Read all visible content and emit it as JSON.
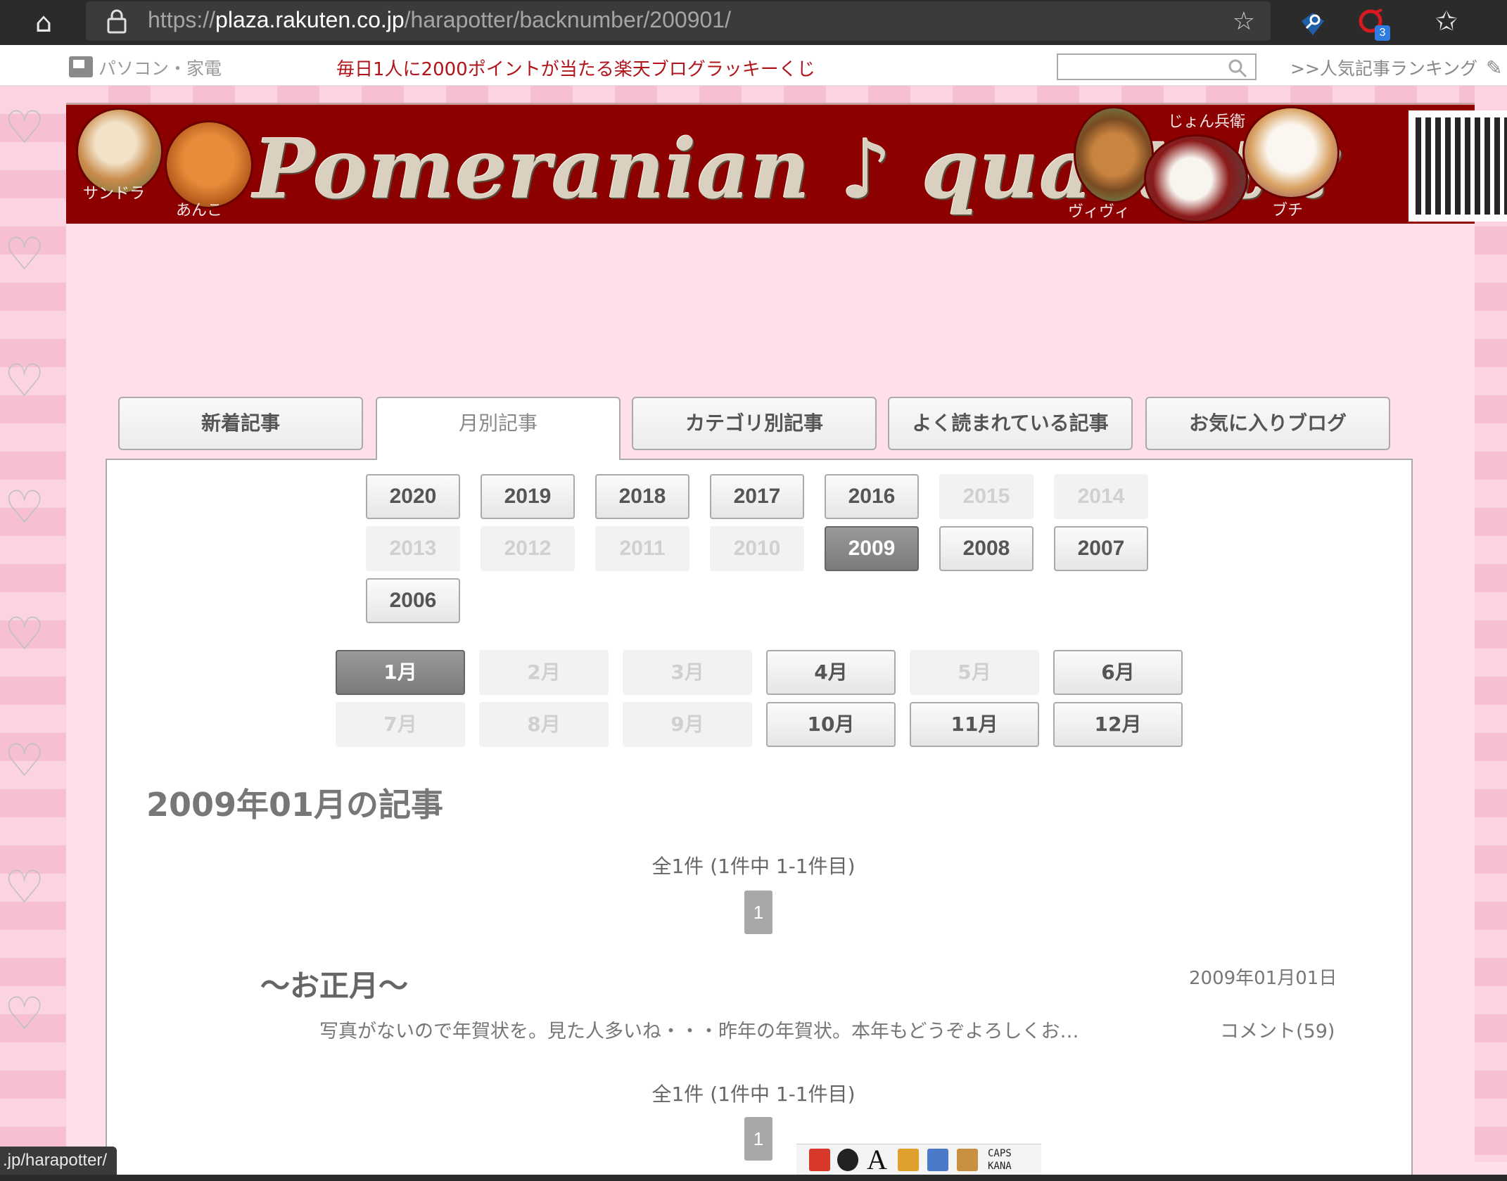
{
  "browser": {
    "url_prefix": "https://",
    "url_host": "plaza.rakuten.co.jp",
    "url_path": "/harapotter/backnumber/200901/",
    "extension_badge": "3",
    "status_url": ".jp/harapotter/"
  },
  "topbar": {
    "category": "パソコン・家電",
    "lottery": "毎日1人に2000ポイントが当たる楽天ブログラッキーくじ",
    "search_placeholder": "",
    "ranking": ">>人気記事ランキング"
  },
  "banner": {
    "title": "Pomeranian ♪ quartet ♪",
    "dogs": [
      "サンドラ",
      "あんこ",
      "ヴィヴィ",
      "じょん兵衛",
      "ブチ"
    ]
  },
  "tabs": [
    "新着記事",
    "月別記事",
    "カテゴリ別記事",
    "よく読まれている記事",
    "お気に入りブログ"
  ],
  "years": [
    {
      "label": "2020",
      "state": "enabled"
    },
    {
      "label": "2019",
      "state": "enabled"
    },
    {
      "label": "2018",
      "state": "enabled"
    },
    {
      "label": "2017",
      "state": "enabled"
    },
    {
      "label": "2016",
      "state": "enabled"
    },
    {
      "label": "2015",
      "state": "disabled"
    },
    {
      "label": "2014",
      "state": "disabled"
    },
    {
      "label": "2013",
      "state": "disabled"
    },
    {
      "label": "2012",
      "state": "disabled"
    },
    {
      "label": "2011",
      "state": "disabled"
    },
    {
      "label": "2010",
      "state": "disabled"
    },
    {
      "label": "2009",
      "state": "current"
    },
    {
      "label": "2008",
      "state": "enabled"
    },
    {
      "label": "2007",
      "state": "enabled"
    },
    {
      "label": "2006",
      "state": "enabled"
    }
  ],
  "months": [
    {
      "label": "1月",
      "state": "current"
    },
    {
      "label": "2月",
      "state": "disabled"
    },
    {
      "label": "3月",
      "state": "disabled"
    },
    {
      "label": "4月",
      "state": "enabled"
    },
    {
      "label": "5月",
      "state": "disabled"
    },
    {
      "label": "6月",
      "state": "enabled"
    },
    {
      "label": "7月",
      "state": "disabled"
    },
    {
      "label": "8月",
      "state": "disabled"
    },
    {
      "label": "9月",
      "state": "disabled"
    },
    {
      "label": "10月",
      "state": "enabled"
    },
    {
      "label": "11月",
      "state": "enabled"
    },
    {
      "label": "12月",
      "state": "enabled"
    }
  ],
  "archive": {
    "heading": "2009年01月の記事",
    "count": "全1件 (1件中 1-1件目)",
    "page": "1"
  },
  "entry": {
    "title": "～お正月～",
    "date": "2009年01月01日",
    "excerpt": "写真がないので年賀状を。見た人多いね・・・昨年の年賀状。本年もどうぞよろしくお…",
    "comments": "コメント(59)"
  },
  "ime": {
    "caps": "CAPS",
    "kana": "KANA"
  },
  "colors": {
    "accent_red": "#b0151c",
    "banner_bg": "#8c0000",
    "page_bg": "#ffdfe9",
    "current_btn": "#8a8a8a"
  }
}
